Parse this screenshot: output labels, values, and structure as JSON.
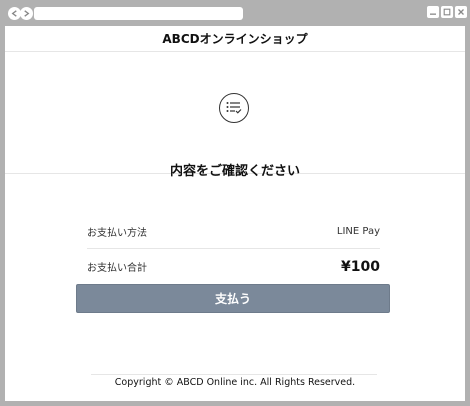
{
  "header": {
    "title": "ABCDオンラインショップ"
  },
  "confirm": {
    "title": "内容をご確認ください",
    "icon": "list-check-icon"
  },
  "summary": {
    "method_label": "お支払い方法",
    "method_value": "LINE Pay",
    "total_label": "お支払い合計",
    "total_value": "¥100"
  },
  "actions": {
    "pay_label": "支払う"
  },
  "footer": {
    "copyright": "Copyright © ABCD Online inc. All Rights Reserved."
  },
  "colors": {
    "pay_button": "#7b899a",
    "chrome": "#b1b1b1"
  }
}
